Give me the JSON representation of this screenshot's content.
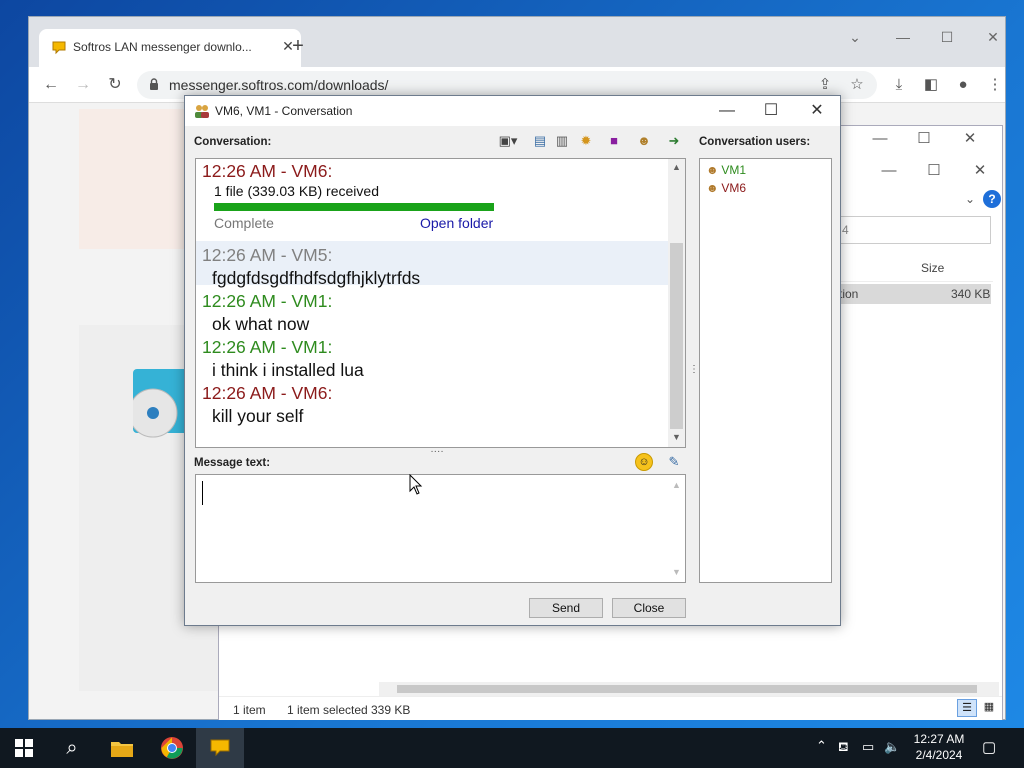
{
  "browser": {
    "tab_title": "Softros LAN messenger downlo...",
    "url": "messenger.softros.com/downloads/"
  },
  "explorer": {
    "column_size": "Size",
    "row_name": "tion",
    "row_size": "340 KB",
    "search_partial": "4",
    "status_items": "1 item",
    "status_selected": "1 item selected",
    "status_size": "339 KB"
  },
  "conversation": {
    "title": "VM6, VM1 - Conversation",
    "conversation_label": "Conversation:",
    "users_label": "Conversation users:",
    "message_label": "Message text:",
    "send_label": "Send",
    "close_label": "Close",
    "file_transfer": {
      "time": "12:26 AM - VM6:",
      "text": "1 file (339.03 KB) received",
      "progress": 1.0,
      "status": "Complete",
      "open_folder": "Open folder"
    },
    "messages": [
      {
        "time": "12:26 AM - VM5:",
        "text": "fgdgfdsgdfhdfsdgfhjklytrfds",
        "color": "#808080"
      },
      {
        "time": "12:26 AM - VM1:",
        "text": "ok what now",
        "color": "#2e8b1e"
      },
      {
        "time": "12:26 AM - VM1:",
        "text": "i think i installed lua",
        "color": "#2e8b1e"
      },
      {
        "time": "12:26 AM - VM6:",
        "text": "kill your self",
        "color": "#8b1a1a"
      }
    ],
    "users": [
      "VM1",
      "VM6"
    ],
    "colors": {
      "vm6": "#8b1a1a",
      "vm1": "#2e8b1e",
      "vm5": "#808080",
      "progress": "#1aa31a",
      "link": "#1a1aa8"
    }
  },
  "taskbar": {
    "time": "12:27 AM",
    "date": "2/4/2024"
  }
}
